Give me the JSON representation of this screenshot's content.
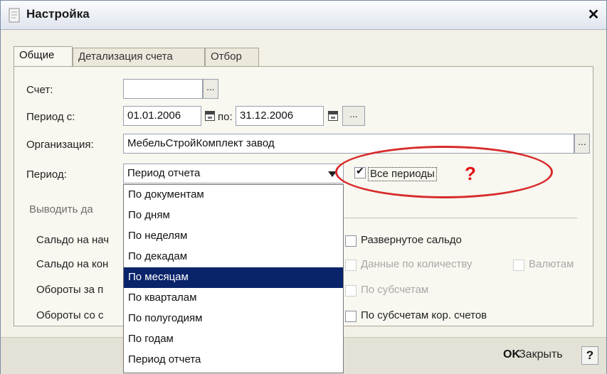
{
  "window": {
    "title": "Настройка",
    "close_glyph": "✕"
  },
  "tabs": [
    {
      "label": "Общие",
      "active": true
    },
    {
      "label": "Детализация счета",
      "active": false
    },
    {
      "label": "Отбор",
      "active": false
    }
  ],
  "form": {
    "account_label": "Счет:",
    "account_value": "",
    "period_from_label": "Период с:",
    "date_from": "01.01.2006",
    "to_label": "по:",
    "date_to": "31.12.2006",
    "organization_label": "Организация:",
    "organization_value": "МебельСтройКомплект завод",
    "period_label": "Период:",
    "period_value": "Период отчета",
    "all_periods_label": "Все периоды",
    "all_periods_checked": true,
    "ellipsis": "...",
    "section_title": "Выводить да"
  },
  "rows": [
    {
      "label": "Сальдо на нач",
      "option": "Развернутое сальдо",
      "disabled": false
    },
    {
      "label": "Сальдо на кон",
      "option": "Данные по количеству",
      "option2": "Валютам",
      "disabled": true
    },
    {
      "label": "Обороты за п",
      "option": "По субсчетам",
      "disabled": true
    },
    {
      "label": "Обороты со с",
      "option": "По субсчетам кор. счетов",
      "disabled": false
    }
  ],
  "dropdown_options": [
    "По документам",
    "По дням",
    "По неделям",
    "По декадам",
    "По месяцам",
    "По кварталам",
    "По полугодиям",
    "По годам",
    "Период отчета"
  ],
  "selected_option": "По месяцам",
  "annotation": {
    "mark": "?",
    "color": "#d82a2a"
  },
  "footer": {
    "ok_label": "OK",
    "close_label": "Закрыть",
    "help_label": "?"
  }
}
